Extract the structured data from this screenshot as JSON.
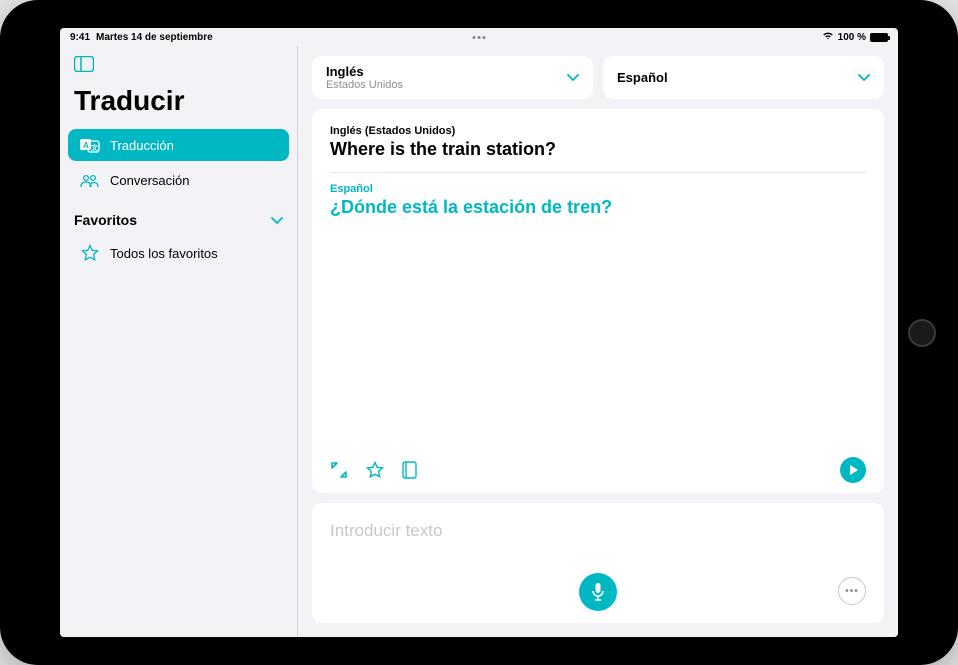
{
  "status": {
    "time": "9:41",
    "date": "Martes 14 de septiembre",
    "battery_text": "100 %"
  },
  "sidebar": {
    "title": "Traducir",
    "items": [
      {
        "label": "Traducción"
      },
      {
        "label": "Conversación"
      }
    ],
    "favorites_header": "Favoritos",
    "favorites_all": "Todos los favoritos"
  },
  "lang": {
    "source": {
      "name": "Inglés",
      "sub": "Estados Unidos"
    },
    "target": {
      "name": "Español",
      "sub": ""
    }
  },
  "translation": {
    "source_lang_label": "Inglés (Estados Unidos)",
    "source_text": "Where is the train station?",
    "target_lang_label": "Español",
    "target_text": "¿Dónde está la estación de tren?"
  },
  "input": {
    "placeholder": "Introducir texto"
  }
}
